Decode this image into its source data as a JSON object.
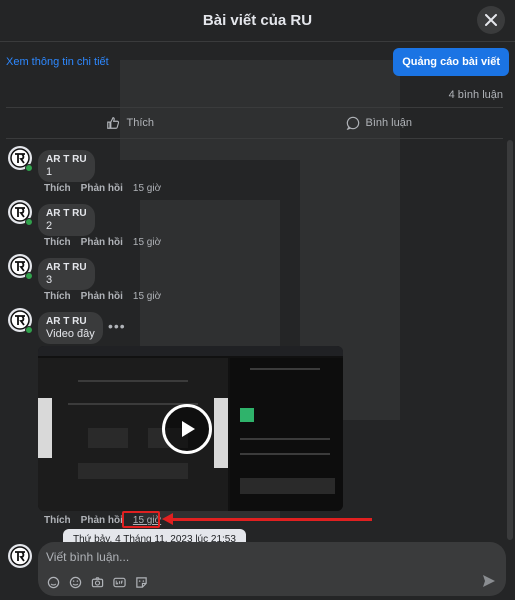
{
  "header": {
    "title": "Bài viết của RU"
  },
  "subbar": {
    "details_link": "Xem thông tin chi tiết",
    "ad_button": "Quảng cáo bài viết"
  },
  "stats": {
    "comment_count": "4 bình luận"
  },
  "actions": {
    "like": "Thích",
    "comment": "Bình luận"
  },
  "comments": [
    {
      "author": "AR T RU",
      "text": "1",
      "like": "Thích",
      "reply": "Phản hồi",
      "time": "15 giờ"
    },
    {
      "author": "AR T RU",
      "text": "2",
      "like": "Thích",
      "reply": "Phản hồi",
      "time": "15 giờ"
    },
    {
      "author": "AR T RU",
      "text": "3",
      "like": "Thích",
      "reply": "Phản hồi",
      "time": "15 giờ"
    },
    {
      "author": "AR T RU",
      "text": "Video đây",
      "like": "Thích",
      "reply": "Phản hồi",
      "time": "15 giờ",
      "has_video": true
    }
  ],
  "tooltip": {
    "text": "Thứ bảy, 4 Tháng 11, 2023 lúc 21:53"
  },
  "composer": {
    "placeholder": "Viết bình luận..."
  },
  "colors": {
    "background": "#242526",
    "bubble": "#3a3b3c",
    "accent": "#1b74e4",
    "annotation": "#e02020",
    "online": "#31a24c"
  }
}
